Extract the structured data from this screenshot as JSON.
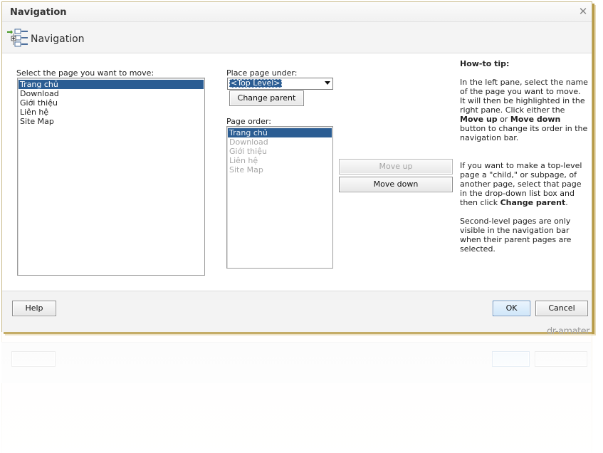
{
  "window": {
    "title": "Navigation"
  },
  "header": {
    "title": "Navigation",
    "icon": "navigation-tree-icon"
  },
  "left_pane": {
    "label": "Select the page you want to move:",
    "items": [
      "Trang chủ",
      "Download",
      "Giới thiệu",
      "Liên hệ",
      "Site Map"
    ],
    "selected_index": 0
  },
  "place_under": {
    "label": "Place page under:",
    "value": "<Top Level>",
    "change_parent_label": "Change parent"
  },
  "page_order": {
    "label": "Page order:",
    "items": [
      "Trang chủ",
      "Download",
      "Giới thiệu",
      "Liên hệ",
      "Site Map"
    ],
    "selected_index": 0,
    "move_up_label": "Move up",
    "move_down_label": "Move down"
  },
  "tip": {
    "title": "How-to tip:",
    "p1_a": "In the left pane, select the name of the page you want to move. It will then be highlighted in the right pane. Click either the ",
    "p1_b": "Move up",
    "p1_c": " or ",
    "p1_d": "Move down",
    "p1_e": " button to change its order in the navigation bar.",
    "p2_a": "If you want to make a top-level page a \"child,\" or subpage, of another page, select that page in the drop-down list box and then click ",
    "p2_b": "Change parent",
    "p2_c": ".",
    "p3": "Second-level pages are only visible in the navigation bar when their parent pages are selected."
  },
  "footer": {
    "help_label": "Help",
    "ok_label": "OK",
    "cancel_label": "Cancel"
  },
  "watermark": "dr-amater",
  "colors": {
    "selection": "#2b5d93",
    "frame_shadow": "#b79a47"
  }
}
